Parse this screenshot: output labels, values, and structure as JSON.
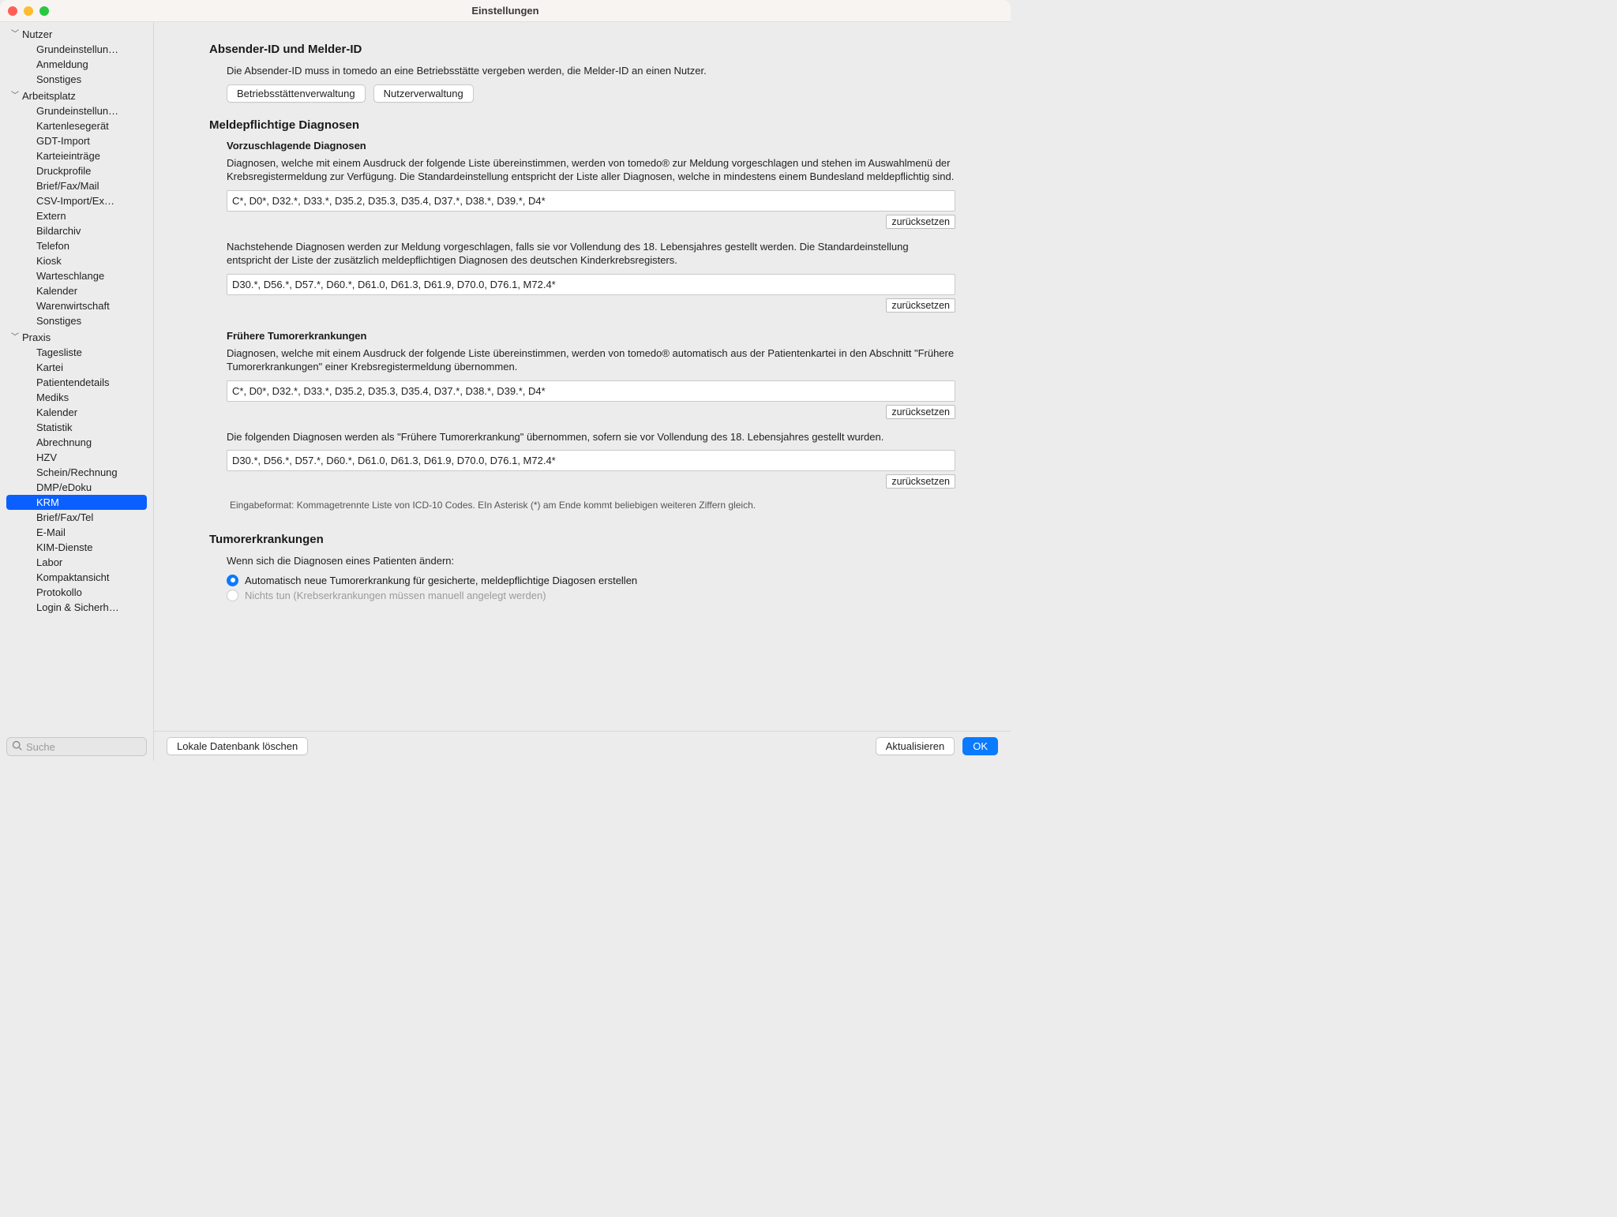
{
  "window": {
    "title": "Einstellungen"
  },
  "sidebar": {
    "groups": [
      {
        "label": "Nutzer",
        "items": [
          {
            "label": "Grundeinstellun…"
          },
          {
            "label": "Anmeldung"
          },
          {
            "label": "Sonstiges"
          }
        ]
      },
      {
        "label": "Arbeitsplatz",
        "items": [
          {
            "label": "Grundeinstellun…"
          },
          {
            "label": "Kartenlesegerät"
          },
          {
            "label": "GDT-Import"
          },
          {
            "label": "Karteieinträge"
          },
          {
            "label": "Druckprofile"
          },
          {
            "label": "Brief/Fax/Mail"
          },
          {
            "label": "CSV-Import/Ex…"
          },
          {
            "label": "Extern"
          },
          {
            "label": "Bildarchiv"
          },
          {
            "label": "Telefon"
          },
          {
            "label": "Kiosk"
          },
          {
            "label": "Warteschlange"
          },
          {
            "label": "Kalender"
          },
          {
            "label": "Warenwirtschaft"
          },
          {
            "label": "Sonstiges"
          }
        ]
      },
      {
        "label": "Praxis",
        "items": [
          {
            "label": "Tagesliste"
          },
          {
            "label": "Kartei"
          },
          {
            "label": "Patientendetails"
          },
          {
            "label": "Mediks"
          },
          {
            "label": "Kalender"
          },
          {
            "label": "Statistik"
          },
          {
            "label": "Abrechnung"
          },
          {
            "label": "HZV"
          },
          {
            "label": "Schein/Rechnung"
          },
          {
            "label": "DMP/eDoku"
          },
          {
            "label": "KRM",
            "selected": true
          },
          {
            "label": "Brief/Fax/Tel"
          },
          {
            "label": "E-Mail"
          },
          {
            "label": "KIM-Dienste"
          },
          {
            "label": "Labor"
          },
          {
            "label": "Kompaktansicht"
          },
          {
            "label": "Protokollo"
          },
          {
            "label": "Login & Sicherh…"
          }
        ]
      }
    ],
    "search_placeholder": "Suche"
  },
  "main": {
    "sender": {
      "title": "Absender-ID und Melder-ID",
      "desc": "Die Absender-ID muss in tomedo an eine Betriebsstätte vergeben werden, die Melder-ID an einen Nutzer.",
      "btn_sites": "Betriebsstättenverwaltung",
      "btn_users": "Nutzerverwaltung"
    },
    "reportable": {
      "title": "Meldepflichtige Diagnosen",
      "suggested": {
        "title": "Vorzuschlagende Diagnosen",
        "desc1": "Diagnosen, welche mit einem Ausdruck der folgende Liste übereinstimmen, werden von tomedo® zur Meldung vorgeschlagen und stehen im Auswahlmenü der Krebsregistermeldung zur Verfügung. Die Standardeinstellung entspricht der Liste aller Diagnosen, welche in mindestens einem Bundesland meldepflichtig sind.",
        "field1": "C*, D0*, D32.*, D33.*, D35.2, D35.3, D35.4, D37.*, D38.*, D39.*, D4*",
        "reset": "zurücksetzen",
        "desc2": "Nachstehende Diagnosen werden zur Meldung vorgeschlagen, falls sie vor Vollendung des 18. Lebensjahres gestellt werden. Die Standardeinstellung entspricht der Liste der zusätzlich meldepflichtigen Diagnosen des deutschen Kinderkrebsregisters.",
        "field2": "D30.*, D56.*, D57.*, D60.*, D61.0, D61.3, D61.9, D70.0, D76.1, M72.4*"
      },
      "prior": {
        "title": "Frühere Tumorerkrankungen",
        "desc1": "Diagnosen, welche mit einem Ausdruck der folgende Liste übereinstimmen, werden von tomedo® automatisch aus der Patientenkartei in den Abschnitt \"Frühere Tumorerkrankungen\" einer Krebsregistermeldung übernommen.",
        "field1": "C*, D0*, D32.*, D33.*, D35.2, D35.3, D35.4, D37.*, D38.*, D39.*, D4*",
        "desc2": "Die folgenden Diagnosen werden als \"Frühere Tumorerkrankung\" übernommen, sofern sie vor Vollendung des 18. Lebensjahres gestellt wurden.",
        "field2": "D30.*, D56.*, D57.*, D60.*, D61.0, D61.3, D61.9, D70.0, D76.1, M72.4*",
        "hint": "Eingabeformat: Kommagetrennte Liste von ICD-10 Codes. EIn Asterisk (*) am Ende kommt beliebigen weiteren Ziffern gleich."
      }
    },
    "tumor": {
      "title": "Tumorerkrankungen",
      "intro": "Wenn sich die Diagnosen eines Patienten ändern:",
      "option1": "Automatisch neue Tumorerkrankung für gesicherte, meldepflichtige Diagosen erstellen",
      "option2": "Nichts tun (Krebserkrankungen müssen manuell angelegt werden)"
    }
  },
  "footer": {
    "delete_db": "Lokale Datenbank löschen",
    "refresh": "Aktualisieren",
    "ok": "OK"
  }
}
